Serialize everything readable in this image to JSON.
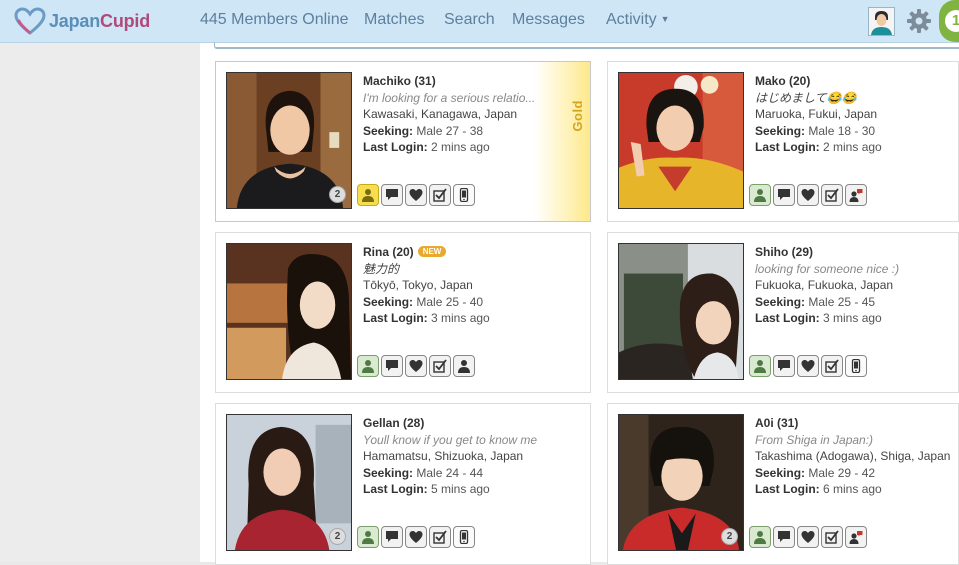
{
  "app": {
    "logo_part1": "Japan",
    "logo_part2": "Cupid",
    "members_online": "445 Members Online",
    "nav": [
      "Matches",
      "Search",
      "Messages",
      "Activity"
    ],
    "notification_count": "1"
  },
  "colors": {
    "topbar": "#cfe6f6",
    "nav_text": "#5d7f9e",
    "brand_blue": "#5b8fb8",
    "brand_pink": "#b04a7c",
    "gold": "#d2a51b",
    "online_green": "#7fb440"
  },
  "profiles": [
    {
      "name": "Machiko (31)",
      "tagline": "I'm looking for a serious relatio...",
      "location": "Kawasaki, Kanagawa, Japan",
      "seeking_label": "Seeking:",
      "seeking": "Male 27 - 38",
      "login_label": "Last Login:",
      "last_login": "2 mins ago",
      "photo_count": "2",
      "gold": true,
      "gold_label": "Gold",
      "actions": [
        "profile-icon",
        "message-icon",
        "heart-icon",
        "checkbox-icon",
        "mobile-icon"
      ]
    },
    {
      "name": "Mako (20)",
      "tagline": "はじめまして😂😂",
      "location": "Maruoka, Fukui, Japan",
      "seeking_label": "Seeking:",
      "seeking": "Male 18 - 30",
      "login_label": "Last Login:",
      "last_login": "2 mins ago",
      "actions": [
        "profile-icon",
        "message-icon",
        "heart-icon",
        "checkbox-icon",
        "chat-user-icon"
      ]
    },
    {
      "name": "Rina (20)",
      "new_badge": "NEW",
      "tagline": "魅力的",
      "location": "Tōkyō, Tokyo, Japan",
      "seeking_label": "Seeking:",
      "seeking": "Male 25 - 40",
      "login_label": "Last Login:",
      "last_login": "3 mins ago",
      "actions": [
        "profile-icon",
        "message-icon",
        "heart-icon",
        "checkbox-icon",
        "user-icon"
      ]
    },
    {
      "name": "Shiho (29)",
      "tagline": "looking for someone nice :)",
      "location": "Fukuoka, Fukuoka, Japan",
      "seeking_label": "Seeking:",
      "seeking": "Male 25 - 45",
      "login_label": "Last Login:",
      "last_login": "3 mins ago",
      "actions": [
        "profile-icon",
        "message-icon",
        "heart-icon",
        "checkbox-icon",
        "mobile-icon"
      ]
    },
    {
      "name": "Gellan (28)",
      "tagline": "Youll know if you get to know me",
      "location": "Hamamatsu, Shizuoka, Japan",
      "seeking_label": "Seeking:",
      "seeking": "Male 24 - 44",
      "login_label": "Last Login:",
      "last_login": "5 mins ago",
      "photo_count": "2",
      "actions": [
        "profile-icon",
        "message-icon",
        "heart-icon",
        "checkbox-icon",
        "mobile-icon"
      ]
    },
    {
      "name": "A0i (31)",
      "tagline": "From Shiga in Japan:)",
      "location": "Takashima (Adogawa), Shiga, Japan",
      "seeking_label": "Seeking:",
      "seeking": "Male 29 - 42",
      "login_label": "Last Login:",
      "last_login": "6 mins ago",
      "photo_count": "2",
      "actions": [
        "profile-icon",
        "message-icon",
        "heart-icon",
        "checkbox-icon",
        "chat-user-icon"
      ]
    }
  ]
}
